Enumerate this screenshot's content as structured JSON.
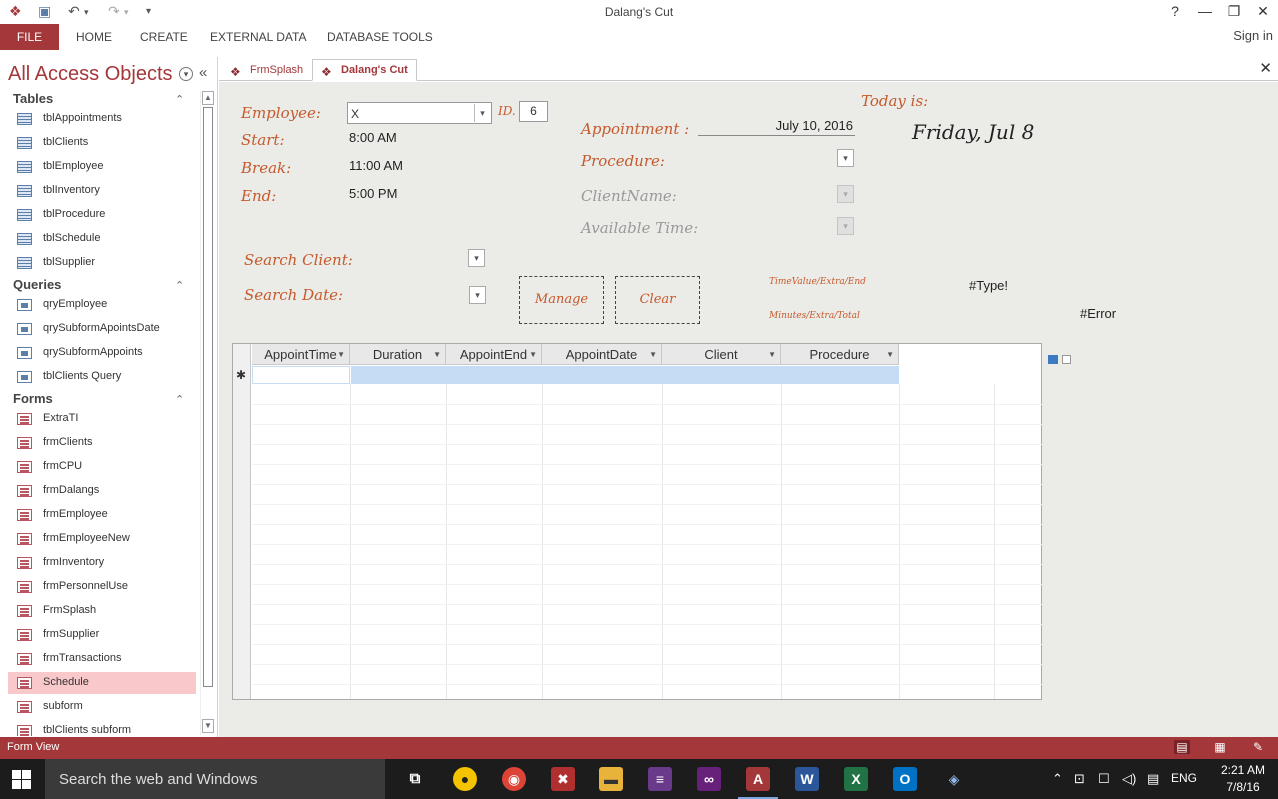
{
  "window": {
    "title": "Dalang's Cut",
    "help": "?",
    "minimize": "—",
    "restore": "❐",
    "close": "✕"
  },
  "quick_access": {
    "undo": "↶",
    "redo": "↷",
    "customize": "▾"
  },
  "ribbon": {
    "file": "FILE",
    "tabs": [
      "HOME",
      "CREATE",
      "EXTERNAL DATA",
      "DATABASE TOOLS"
    ],
    "sign_in": "Sign in"
  },
  "nav": {
    "title": "All Access Objects",
    "groups": {
      "tables": {
        "label": "Tables",
        "items": [
          "tblAppointments",
          "tblClients",
          "tblEmployee",
          "tblInventory",
          "tblProcedure",
          "tblSchedule",
          "tblSupplier"
        ]
      },
      "queries": {
        "label": "Queries",
        "items": [
          "qryEmployee",
          "qrySubformApointsDate",
          "qrySubformAppoints",
          "tblClients Query"
        ]
      },
      "forms": {
        "label": "Forms",
        "items": [
          "ExtraTI",
          "frmClients",
          "frmCPU",
          "frmDalangs",
          "frmEmployee",
          "frmEmployeeNew",
          "frmInventory",
          "frmPersonnelUse",
          "FrmSplash",
          "frmSupplier",
          "frmTransactions",
          "Schedule",
          "subform",
          "tblClients subform"
        ]
      }
    },
    "selected": "Schedule"
  },
  "doc_tabs": [
    {
      "label": "FrmSplash",
      "active": false
    },
    {
      "label": "Dalang's Cut",
      "active": true
    }
  ],
  "form": {
    "employee_label": "Employee:",
    "employee_value": "X",
    "id_label": "ID.",
    "id_value": "6",
    "start_label": "Start:",
    "start_value": "8:00 AM",
    "break_label": "Break:",
    "break_value": "11:00 AM",
    "end_label": "End:",
    "end_value": "5:00 PM",
    "today_label": "Today is:",
    "today_value": "Friday, Jul 8",
    "appointment_label": "Appointment :",
    "appointment_value": "July 10, 2016",
    "procedure_label": "Procedure:",
    "client_name_label": "ClientName:",
    "available_time_label": "Available Time:",
    "search_client_label": "Search Client:",
    "search_date_label": "Search Date:",
    "manage_button": "Manage",
    "clear_button": "Clear",
    "time_value_label": "TimeValue/Extra/End",
    "minutes_label": "Minutes/Extra/Total",
    "type_error": "#Type!",
    "error": "#Error"
  },
  "grid": {
    "columns": [
      "AppointTime",
      "Duration",
      "AppointEnd",
      "AppointDate",
      "Client",
      "Procedure"
    ],
    "new_row_marker": "✱"
  },
  "status": {
    "text": "Form View"
  },
  "taskbar": {
    "search_placeholder": "Search the web and Windows",
    "apps": [
      "Task View",
      "Media",
      "Chrome",
      "Tool",
      "File Explorer",
      "Archive",
      "Visual Studio",
      "Access",
      "Word",
      "Excel",
      "Outlook",
      "Remote"
    ],
    "language": "ENG",
    "time": "2:21 AM",
    "date": "7/8/16"
  },
  "colors": {
    "accent": "#a4373a",
    "label": "#c55a2d",
    "form_bg": "#ebebe7",
    "selected_nav": "#f8c8cb",
    "new_row": "#c5dcf4"
  }
}
